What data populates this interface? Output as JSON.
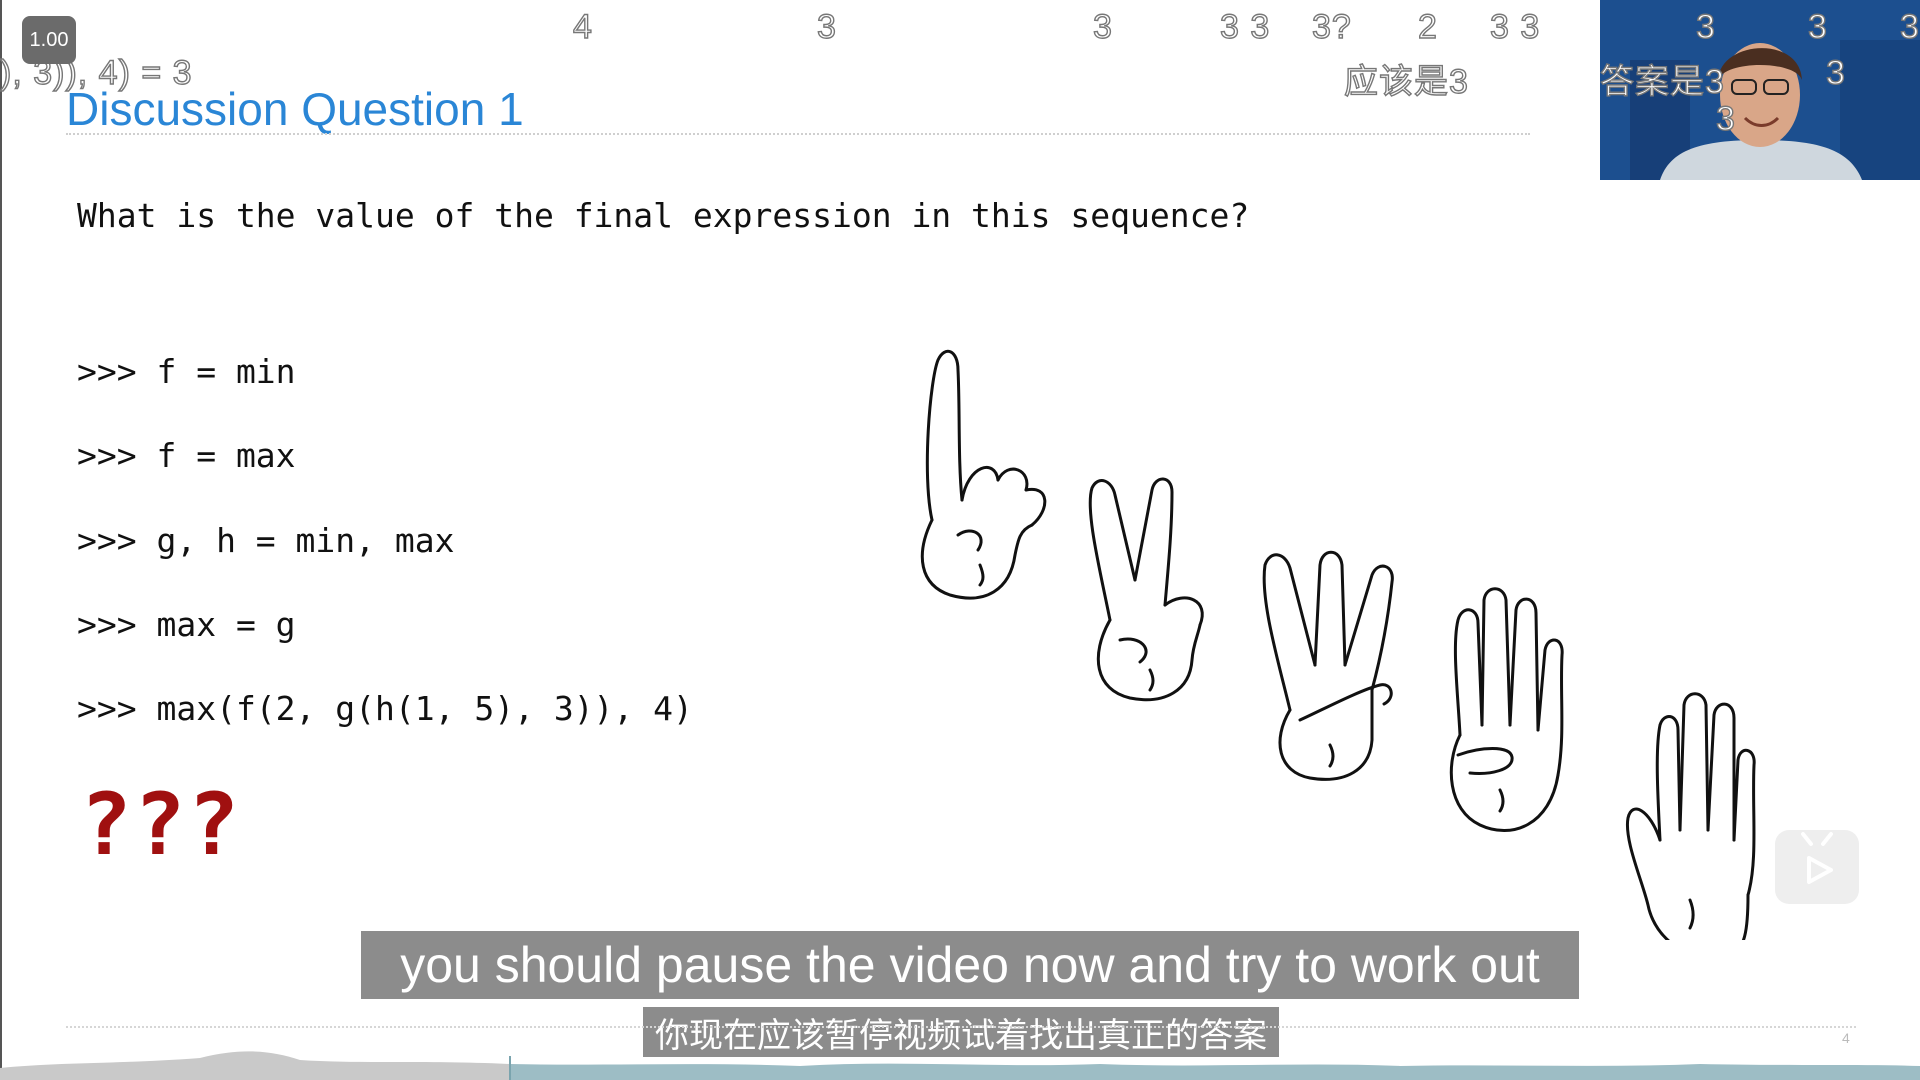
{
  "player": {
    "speed_label": "1.00",
    "page_number": "4",
    "colors": {
      "accent": "#2a86d6",
      "qmark": "#a01010",
      "subtitle_bg": "#787878"
    }
  },
  "slide": {
    "title": "Discussion Question 1",
    "question": "What is the value of the final expression in this sequence?",
    "code_lines": [
      ">>> f = min",
      ">>> f = max",
      ">>> g, h = min, max",
      ">>> max = g",
      ">>> max(f(2, g(h(1, 5), 3)), 4)"
    ],
    "unknown": "???",
    "hands_icons": [
      "one-finger-hand-icon",
      "two-finger-hand-icon",
      "three-finger-hand-icon",
      "four-finger-hand-icon",
      "five-finger-hand-icon"
    ]
  },
  "danmaku": [
    {
      "text": "4"
    },
    {
      "text": "3"
    },
    {
      "text": "3"
    },
    {
      "text": "3 3"
    },
    {
      "text": "3?"
    },
    {
      "text": "2"
    },
    {
      "text": "3 3"
    },
    {
      "text": "3"
    },
    {
      "text": "3"
    },
    {
      "text": "3"
    },
    {
      "text": "), 3)), 4) = 3"
    },
    {
      "text": "应该是3"
    },
    {
      "text": "答案是3"
    },
    {
      "text": "3"
    },
    {
      "text": "3"
    }
  ],
  "subtitles": {
    "english": "you should pause the video now and try to work out",
    "chinese": "你现在应该暂停视频试着找出真正的答案"
  }
}
